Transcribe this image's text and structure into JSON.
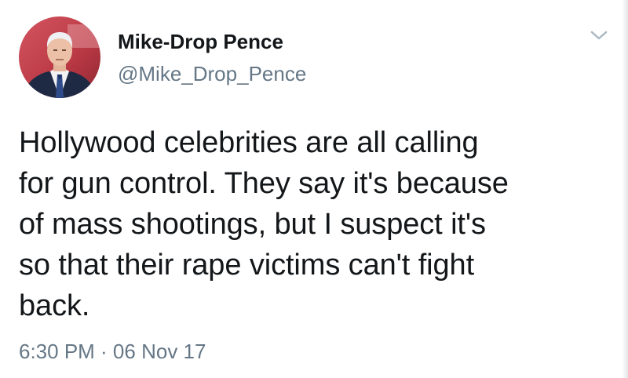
{
  "author": {
    "display_name": "Mike-Drop Pence",
    "handle": "@Mike_Drop_Pence"
  },
  "tweet": {
    "text": "Hollywood celebrities are all calling\nfor gun control. They say it's because\nof mass shootings, but I suspect it's\nso that their rape victims can't fight\nback.",
    "timestamp": "6:30 PM · 06 Nov 17"
  },
  "icons": {
    "menu": "chevron-down-icon",
    "avatar": "profile-photo"
  },
  "colors": {
    "name_text": "#14171a",
    "secondary_text": "#657786",
    "chevron": "#aab8c2",
    "avatar_background": "#c9434f"
  }
}
